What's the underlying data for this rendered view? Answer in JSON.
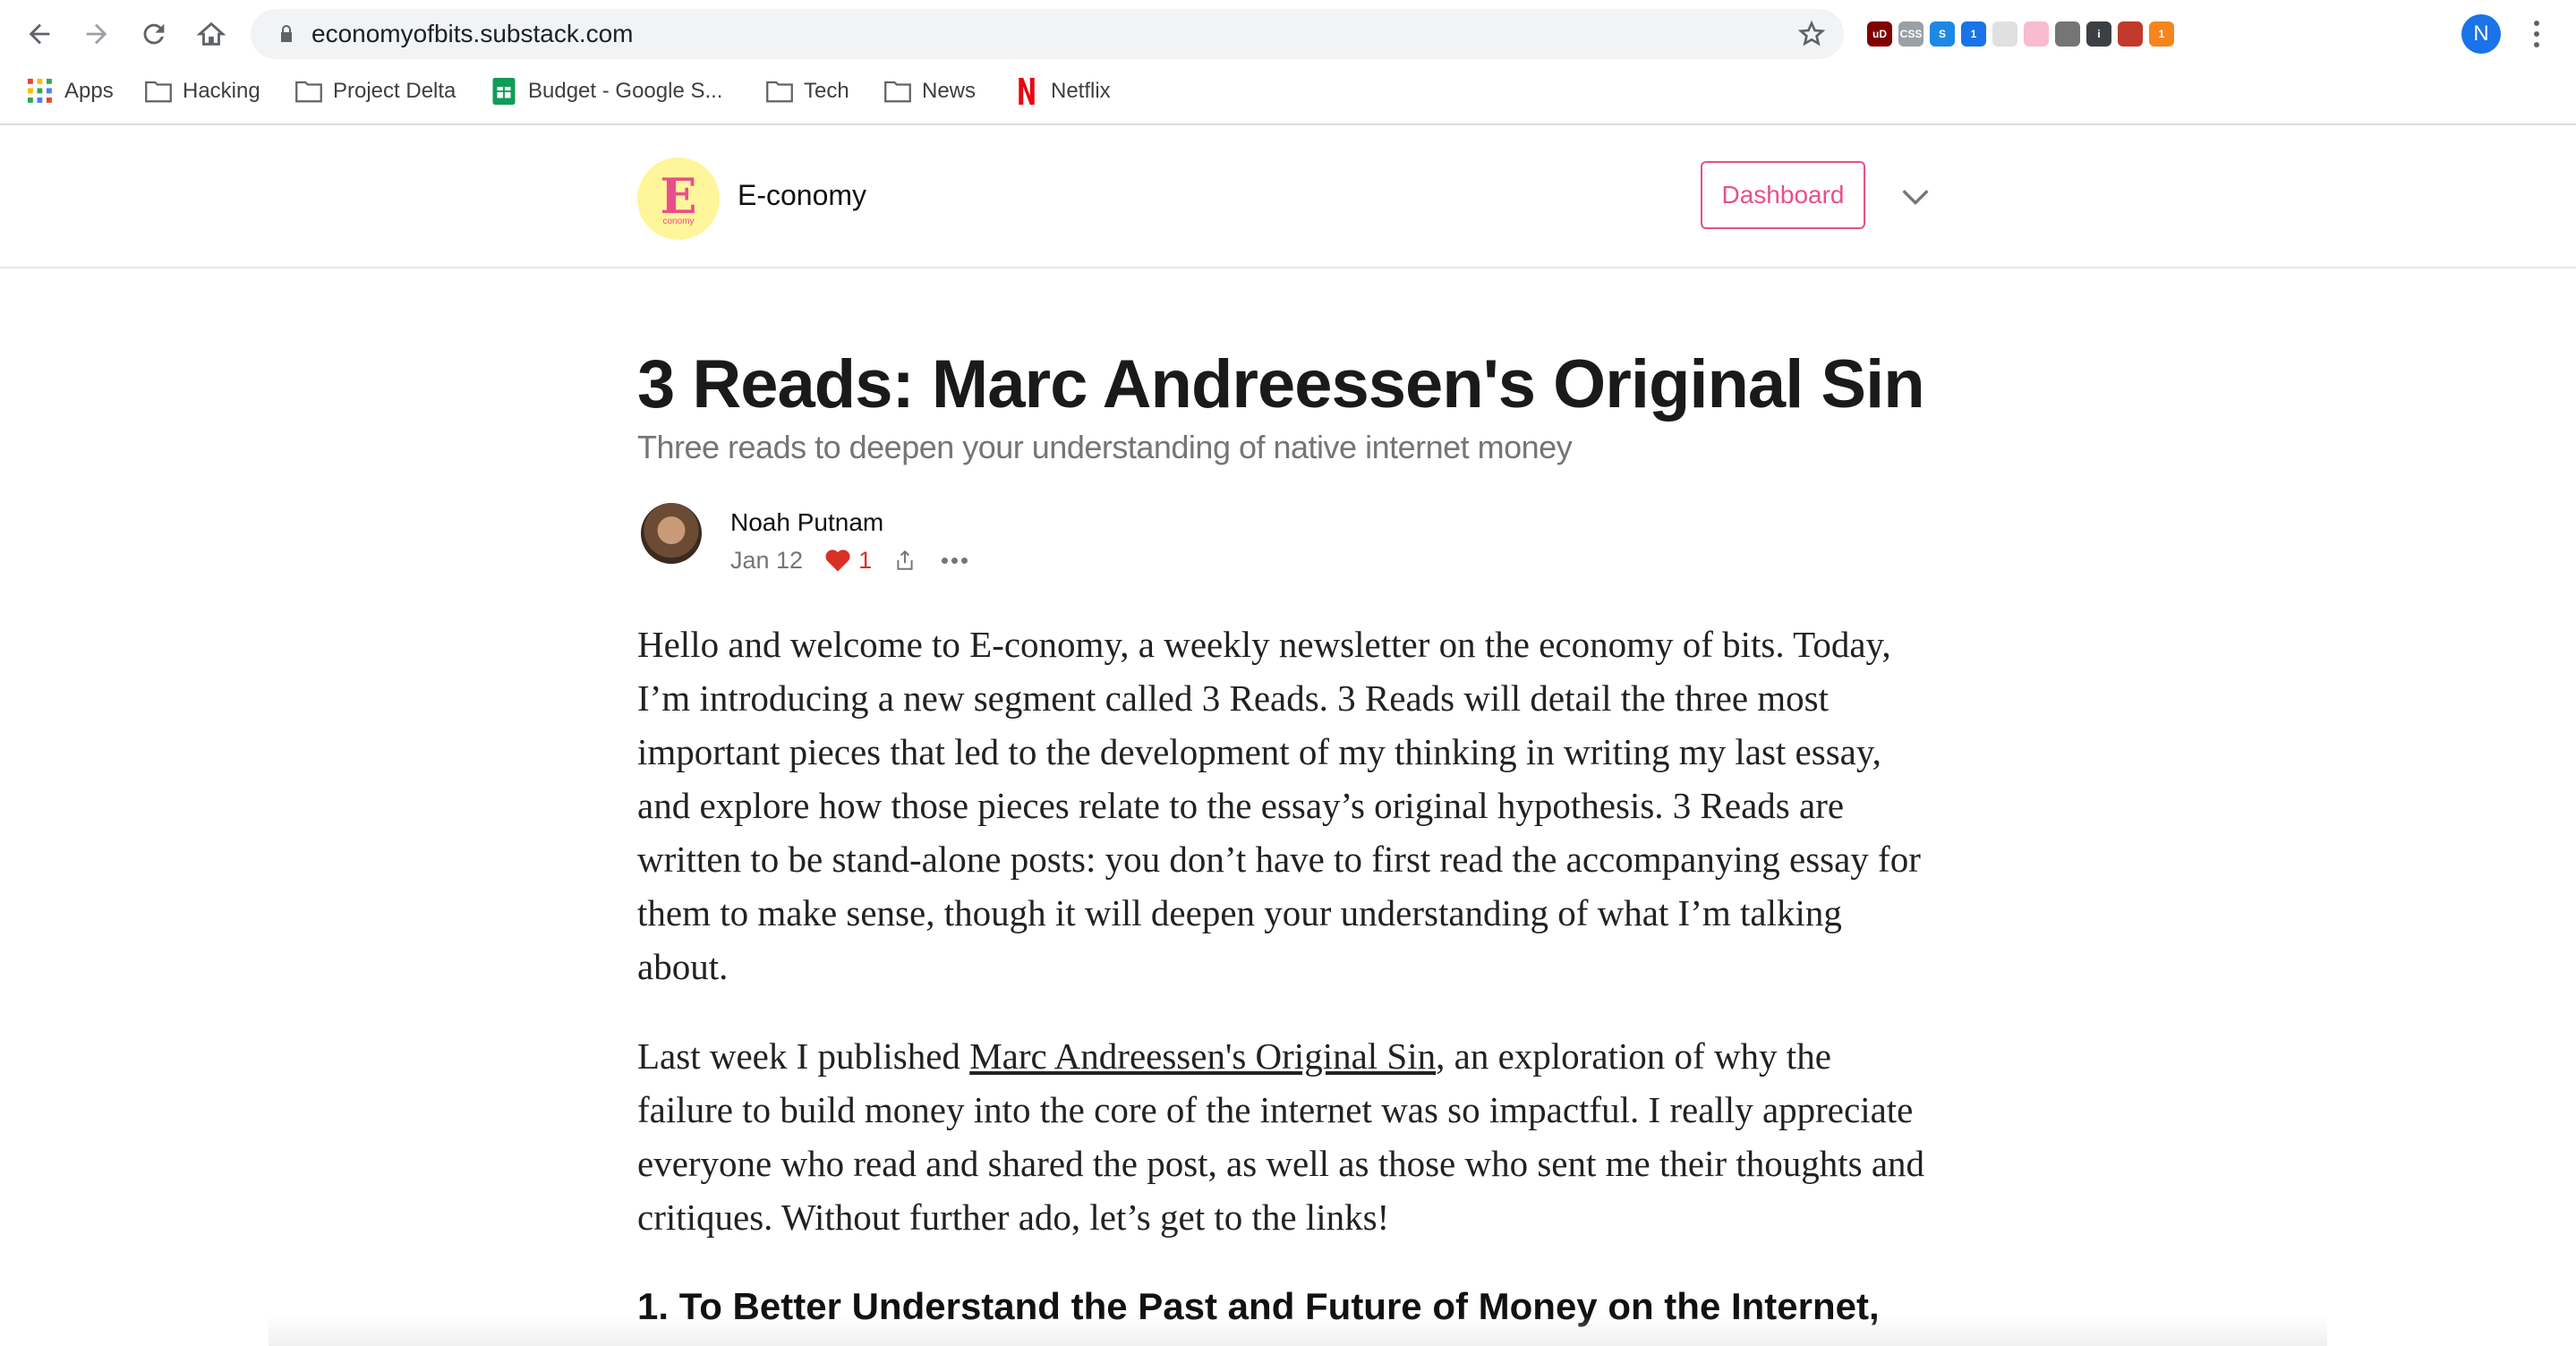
{
  "browser": {
    "url": "economyofbits.substack.com",
    "profile_initial": "N",
    "bookmarks": [
      {
        "label": "Apps",
        "icon": "apps-grid-icon"
      },
      {
        "label": "Hacking",
        "icon": "folder-icon"
      },
      {
        "label": "Project Delta",
        "icon": "folder-icon"
      },
      {
        "label": "Budget - Google S...",
        "icon": "google-sheets-icon"
      },
      {
        "label": "Tech",
        "icon": "folder-icon"
      },
      {
        "label": "News",
        "icon": "folder-icon"
      },
      {
        "label": "Netflix",
        "icon": "netflix-icon"
      }
    ],
    "extensions": [
      {
        "name": "ublock-icon",
        "text": "uD",
        "color": "#800000"
      },
      {
        "name": "css-viewer-icon",
        "text": "CSS",
        "color": "#9aa0a6"
      },
      {
        "name": "s-extension-icon",
        "text": "S",
        "color": "#1e88e5"
      },
      {
        "name": "onepassword-icon",
        "text": "1",
        "color": "#1a73e8"
      },
      {
        "name": "puzzle-extension-icon",
        "text": "",
        "color": "#e0e0e0"
      },
      {
        "name": "eyedropper-icon",
        "text": "",
        "color": "#f8bbd0"
      },
      {
        "name": "speedometer-icon",
        "text": "",
        "color": "#757575"
      },
      {
        "name": "info-icon",
        "text": "i",
        "color": "#3c4043"
      },
      {
        "name": "book-icon",
        "text": "",
        "color": "#c0392b"
      },
      {
        "name": "metamask-icon",
        "text": "1",
        "color": "#f6851b"
      }
    ]
  },
  "header": {
    "publication": "E-conomy",
    "logo_letter": "E",
    "logo_small": "conomy",
    "dashboard_label": "Dashboard",
    "accent_color": "#e94e8c"
  },
  "article": {
    "title": "3 Reads: Marc Andreessen's Original Sin",
    "subtitle": "Three reads to deepen your understanding of native internet money",
    "author": "Noah Putnam",
    "date": "Jan 12",
    "likes": "1",
    "paragraph1": "Hello and welcome to E-conomy, a weekly newsletter on the economy of bits. Today, I’m introducing a new segment called 3 Reads. 3 Reads will detail the three most important pieces that led to the development of my thinking in writing my last essay, and explore how those pieces relate to the essay’s original hypothesis. 3 Reads are written to be stand-alone posts: you don’t have to first read the accompanying essay for them to make sense, though it will deepen your understanding of what I’m talking about.",
    "paragraph2_before": "Last week I published ",
    "paragraph2_link": "Marc Andreessen's Original Sin",
    "paragraph2_after": ", an exploration of why the failure to build money into the core of the internet was so impactful. I really appreciate everyone who read and shared the post, as well as those who sent me their thoughts and critiques. Without further ado, let’s get to the links!",
    "heading1": "1. To Better Understand the Past and Future of Money on the Internet,"
  }
}
